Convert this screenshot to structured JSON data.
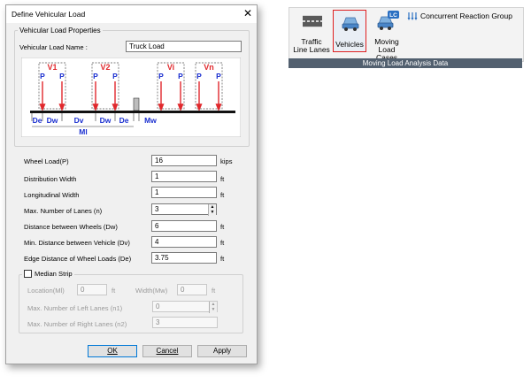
{
  "dialog": {
    "title": "Define Vehicular Load",
    "close_glyph": "✕",
    "group_title": "Vehicular Load Properties",
    "name_label": "Vehicular Load Name :",
    "name_value": "Truck Load",
    "diagram": {
      "lane_labels": [
        "V1",
        "V2",
        "Vi",
        "Vn"
      ],
      "wheel_label": "P",
      "dim_labels": [
        "De",
        "Dw",
        "Dv",
        "Dw",
        "De",
        "Mw"
      ],
      "ml_label": "Ml"
    },
    "fields": [
      {
        "label": "Wheel Load(P)",
        "value": "16",
        "unit": "kips"
      },
      {
        "label": "Distribution Width",
        "value": "1",
        "unit": "ft"
      },
      {
        "label": "Longitudinal Width",
        "value": "1",
        "unit": "ft"
      },
      {
        "label": "Max. Number of Lanes (n)",
        "value": "3",
        "unit": ""
      },
      {
        "label": "Distance between Wheels (Dw)",
        "value": "6",
        "unit": "ft"
      },
      {
        "label": "Min. Distance between Vehicle (Dv)",
        "value": "4",
        "unit": "ft"
      },
      {
        "label": "Edge Distance of Wheel Loads (De)",
        "value": "3.75",
        "unit": "ft"
      }
    ],
    "median": {
      "checkbox_label": "Median Strip",
      "checked": false,
      "location_label": "Location(Ml)",
      "location_value": "0",
      "location_unit": "ft",
      "width_label": "Width(Mw)",
      "width_value": "0",
      "width_unit": "ft",
      "left_lanes_label": "Max. Number of Left Lanes (n1)",
      "left_lanes_value": "0",
      "right_lanes_label": "Max. Number of Right Lanes (n2)",
      "right_lanes_value": "3"
    },
    "buttons": {
      "ok": "OK",
      "cancel": "Cancel",
      "apply": "Apply"
    }
  },
  "ribbon": {
    "items": [
      {
        "line1": "Traffic",
        "line2": "Line Lanes"
      },
      {
        "line1": "Vehicles",
        "line2": ""
      },
      {
        "line1": "Moving",
        "line2": "Load Cases"
      }
    ],
    "concurrent_label": "Concurrent Reaction Group",
    "group_label": "Moving Load Analysis Data",
    "lc_badge": "LC"
  },
  "colors": {
    "accent_red": "#e0282c",
    "diagram_blue": "#1a2fd0",
    "ribbon_foot": "#52606f",
    "highlight": "#e02020"
  }
}
